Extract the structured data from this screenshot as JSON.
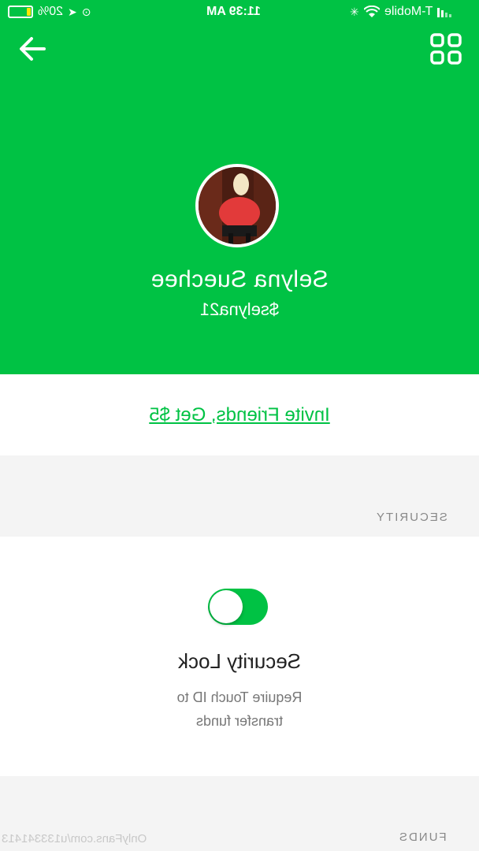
{
  "status_bar": {
    "carrier": "T-Mobile",
    "time": "11:39 AM",
    "battery": "20%",
    "battery_level": 0.2,
    "icons": [
      "signal-icon",
      "wifi-icon",
      "loading-icon",
      "rotation-lock-icon",
      "location-icon",
      "battery-icon"
    ]
  },
  "header": {
    "back_icon": "back-arrow-icon",
    "qr_icon": "qr-code-icon",
    "background_color": "#00c244"
  },
  "profile": {
    "name": "Selyna Suechee",
    "handle": "$selyna21"
  },
  "invite": {
    "label": "Invite Friends, Get $5"
  },
  "sections": {
    "security_label": "SECURITY",
    "funds_label": "FUNDS"
  },
  "security_lock": {
    "title": "Security Lock",
    "description_line1": "Require Touch ID to",
    "description_line2": "transfer funds",
    "enabled": true
  },
  "watermark": "OnlyFans.com/u133341413"
}
